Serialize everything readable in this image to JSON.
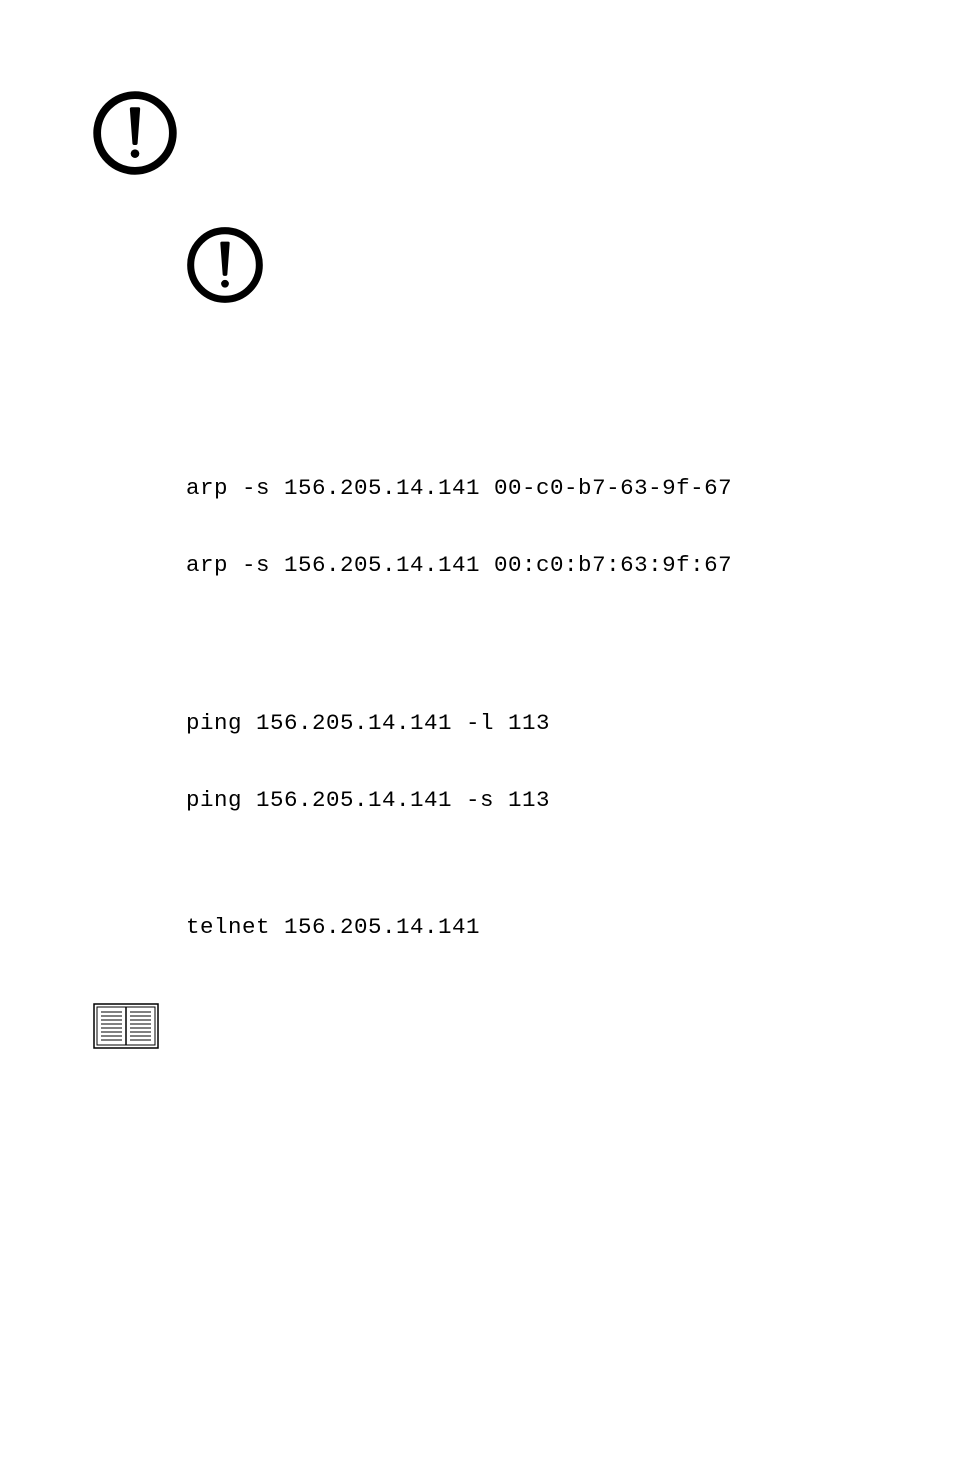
{
  "commands": {
    "arp_windows": "arp -s 156.205.14.141 00-c0-b7-63-9f-67",
    "arp_unix": "arp -s 156.205.14.141 00:c0:b7:63:9f:67",
    "ping_windows": "ping 156.205.14.141 -l 113",
    "ping_unix": "ping 156.205.14.141 -s 113",
    "telnet": "telnet 156.205.14.141"
  }
}
